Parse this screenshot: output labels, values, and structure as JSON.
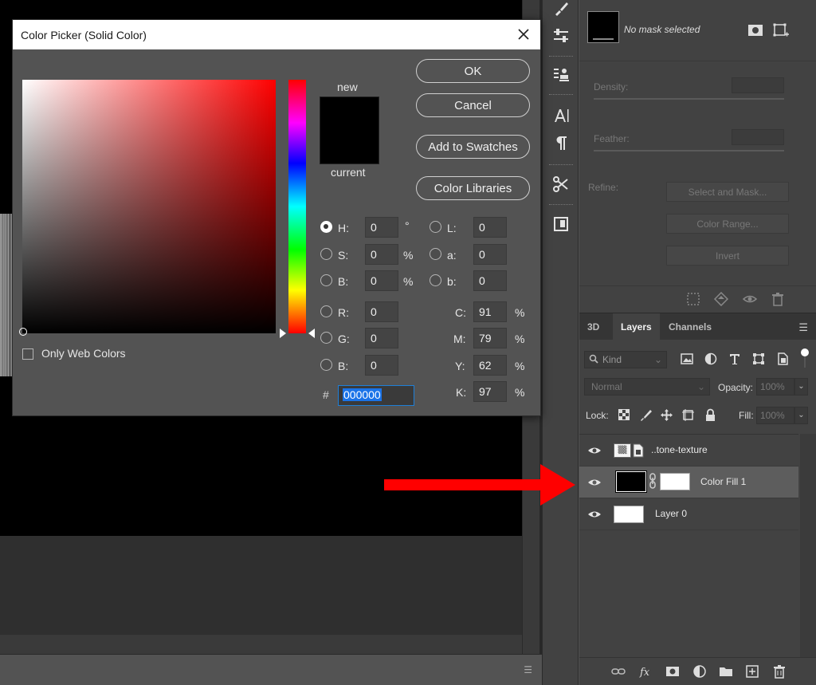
{
  "dialog": {
    "title": "Color Picker (Solid Color)",
    "new_label": "new",
    "current_label": "current",
    "buttons": {
      "ok": "OK",
      "cancel": "Cancel",
      "add_to_swatches": "Add to Swatches",
      "color_libraries": "Color Libraries"
    },
    "only_web_colors": "Only Web Colors",
    "hsb": [
      {
        "label": "H:",
        "value": "0",
        "unit": "°",
        "checked": true
      },
      {
        "label": "S:",
        "value": "0",
        "unit": "%",
        "checked": false
      },
      {
        "label": "B:",
        "value": "0",
        "unit": "%",
        "checked": false
      }
    ],
    "lab": [
      {
        "label": "L:",
        "value": "0"
      },
      {
        "label": "a:",
        "value": "0"
      },
      {
        "label": "b:",
        "value": "0"
      }
    ],
    "rgb": [
      {
        "label": "R:",
        "value": "0"
      },
      {
        "label": "G:",
        "value": "0"
      },
      {
        "label": "B:",
        "value": "0"
      }
    ],
    "cmyk": [
      {
        "label": "C:",
        "value": "91",
        "unit": "%"
      },
      {
        "label": "M:",
        "value": "79",
        "unit": "%"
      },
      {
        "label": "Y:",
        "value": "62",
        "unit": "%"
      },
      {
        "label": "K:",
        "value": "97",
        "unit": "%"
      }
    ],
    "hex_label": "#",
    "hex_value": "000000",
    "new_color": "#000000",
    "current_color": "#000000"
  },
  "properties": {
    "mask_status": "No mask selected",
    "density_label": "Density:",
    "feather_label": "Feather:",
    "refine_label": "Refine:",
    "select_and_mask": "Select and Mask...",
    "color_range": "Color Range...",
    "invert": "Invert"
  },
  "layers_panel": {
    "tabs": [
      "3D",
      "Layers",
      "Channels"
    ],
    "active_tab": "Layers",
    "filter_kind": "Kind",
    "blend_mode": "Normal",
    "opacity_label": "Opacity:",
    "opacity_value": "100%",
    "lock_label": "Lock:",
    "fill_label": "Fill:",
    "fill_value": "100%",
    "layers": [
      {
        "name": "..tone-texture",
        "visible": true,
        "selected": false
      },
      {
        "name": "Color Fill 1",
        "visible": true,
        "selected": true
      },
      {
        "name": "Layer 0",
        "visible": true,
        "selected": false
      }
    ]
  },
  "annotation": {
    "arrow_color": "#ff0000"
  },
  "icons": {
    "tools": [
      "brush-settings-icon",
      "adjustments-icon",
      "clone-source-icon",
      "character-icon",
      "paragraph-icon",
      "tool-presets-icon",
      "artboard-icon"
    ],
    "footer": [
      "link-layers-icon",
      "fx-icon",
      "add-mask-icon",
      "adjustment-layer-icon",
      "group-icon",
      "new-layer-icon",
      "delete-layer-icon"
    ]
  }
}
